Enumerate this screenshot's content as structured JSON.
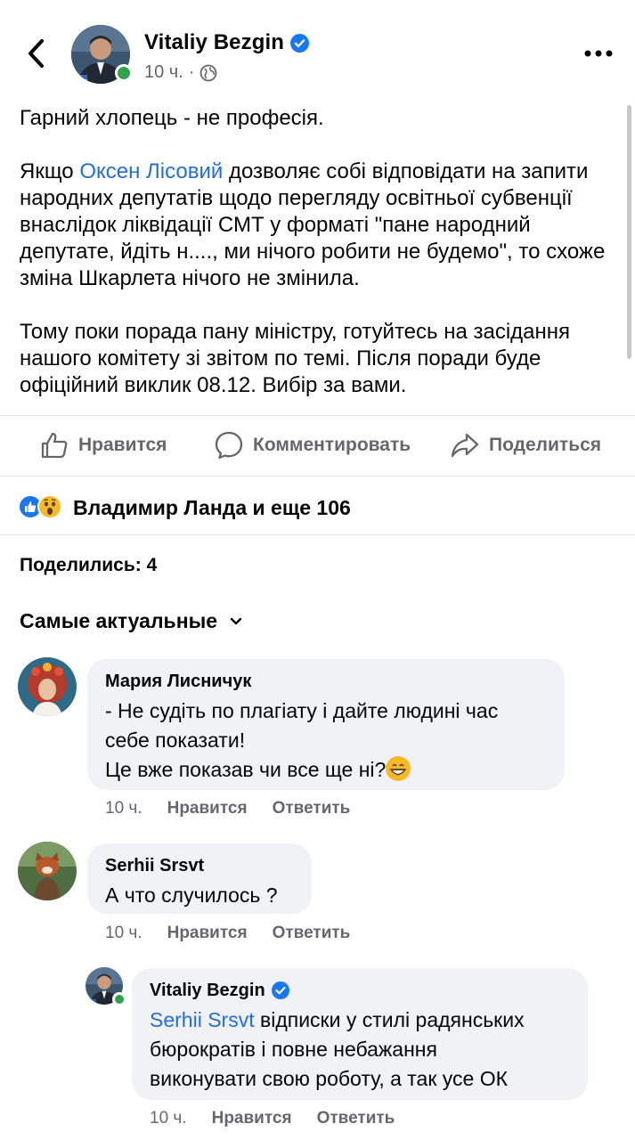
{
  "post": {
    "author": "Vitaliy Bezgin",
    "time": "10 ч.",
    "separator": "·",
    "paragraphs": [
      {
        "text": "Гарний хлопець - не професія."
      },
      {
        "before": "Якщо ",
        "mention": "Оксен Лісовий",
        "after": " дозволяє собі відповідати на запити народних депутатів щодо перегляду освітньої субвенції внаслідок ліквідації СМТ у форматі \"пане народний депутате, йдіть н...., ми нічого робити не будемо\", то схоже зміна Шкарлета нічого не змінила."
      },
      {
        "text": "Тому поки порада пану міністру, готуйтесь на засідання нашого комітету зі звітом по темі. Після поради буде офіційний виклик 08.12. Вибір за вами."
      }
    ]
  },
  "actions": {
    "like": "Нравится",
    "comment": "Комментировать",
    "share": "Поделиться"
  },
  "reactions": {
    "text": "Владимир Ланда и еще 106",
    "icons": [
      "like-icon",
      "wow-icon"
    ]
  },
  "shares": "Поделились: 4",
  "sort": {
    "label": "Самые актуальные"
  },
  "comments": [
    {
      "author": "Мария Лисничук",
      "lines": [
        "- Не судіть по плагіату і дайте людині час",
        "себе показати!",
        "Це вже показав чи все ще ні?"
      ],
      "emoji": "grinning-face-icon",
      "time": "10 ч.",
      "like": "Нравится",
      "reply": "Ответить"
    },
    {
      "author": "Serhii Srsvt",
      "lines": [
        "А что случилось ?"
      ],
      "time": "10 ч.",
      "like": "Нравится",
      "reply": "Ответить"
    },
    {
      "author": "Vitaliy Bezgin",
      "mention": "Serhii Srsvt",
      "first_line_rest": " відписки у стилі радянських",
      "lines": [
        "бюрократів і повне небажання",
        "виконувати свою роботу, а так усе ОК"
      ],
      "time": "10 ч.",
      "like": "Нравится",
      "reply": "Ответить"
    }
  ],
  "colors": {
    "link": "#216fdb",
    "like_blue": "#1877f2",
    "online": "#31a24c",
    "secondary_text": "#65676b",
    "bubble": "#f0f2f5"
  }
}
